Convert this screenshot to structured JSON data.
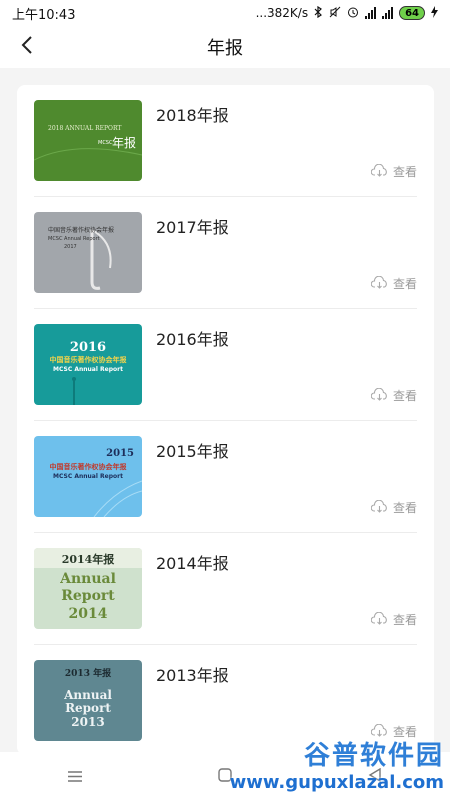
{
  "status_bar": {
    "time": "上午10:43",
    "speed": "...382K/s",
    "battery": "64"
  },
  "header": {
    "title": "年报"
  },
  "reports": [
    {
      "title": "2018年报",
      "view_label": "查看",
      "cover_year": "2018",
      "cover_line1": "2018 ANNUAL REPORT",
      "cover_line2": "年报",
      "cover_tag": "MCSC"
    },
    {
      "title": "2017年报",
      "view_label": "查看",
      "cover_year": "2017",
      "cover_line1": "中国音乐著作权协会年报",
      "cover_line2": "MCSC Annual Report"
    },
    {
      "title": "2016年报",
      "view_label": "查看",
      "cover_year": "2016",
      "cover_line1": "中国音乐著作权协会年报",
      "cover_line2": "MCSC Annual Report"
    },
    {
      "title": "2015年报",
      "view_label": "查看",
      "cover_year": "2015",
      "cover_line1": "中国音乐著作权协会年报",
      "cover_line2": "MCSC Annual Report"
    },
    {
      "title": "2014年报",
      "view_label": "查看",
      "cover_year": "2014年报",
      "cover_line1": "Annual",
      "cover_line2": "Report",
      "cover_line3": "2014"
    },
    {
      "title": "2013年报",
      "view_label": "查看",
      "cover_year": "2013 年报",
      "cover_line1": "Annual",
      "cover_line2": "Report",
      "cover_line3": "2013"
    }
  ],
  "watermark": {
    "text": "谷普软件园",
    "url": "www.gupuxlazal.com"
  },
  "colors": {
    "cover_2018": "#4f8a2e",
    "cover_2017": "#a2a6ab",
    "cover_2016": "#179b9a",
    "cover_2015": "#6ec0ec",
    "cover_2014": "#cfe1cd",
    "cover_2013": "#5f8791"
  }
}
